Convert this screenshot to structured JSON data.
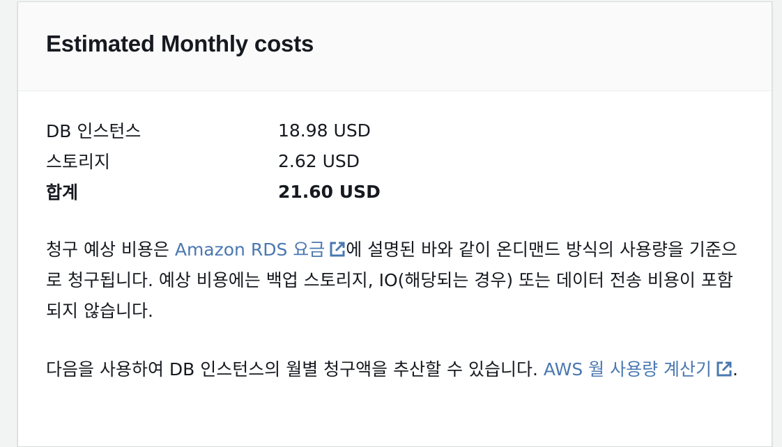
{
  "header": {
    "title": "Estimated Monthly costs"
  },
  "costs": {
    "rows": [
      {
        "label": "DB 인스턴스",
        "value": "18.98 USD"
      },
      {
        "label": "스토리지",
        "value": "2.62 USD"
      }
    ],
    "total": {
      "label": "합계",
      "value": "21.60 USD"
    }
  },
  "paragraph1": {
    "before_link": "청구 예상 비용은 ",
    "link_text": "Amazon RDS 요금",
    "after_link": "에 설명된 바와 같이 온디맨드 방식의 사용량을 기준으로 청구됩니다. 예상 비용에는 백업 스토리지, IO(해당되는 경우) 또는 데이터 전송 비용이 포함되지 않습니다."
  },
  "paragraph2": {
    "before_link": "다음을 사용하여 DB 인스턴스의 월별 청구액을 추산할 수 있습니다. ",
    "link_text": "AWS 월 사용량 계산기",
    "after_link": "."
  },
  "icons": {
    "external_link": "external-link-icon"
  },
  "colors": {
    "link": "#4a78b0",
    "text": "#16191f",
    "header_bg": "#fafafa"
  }
}
